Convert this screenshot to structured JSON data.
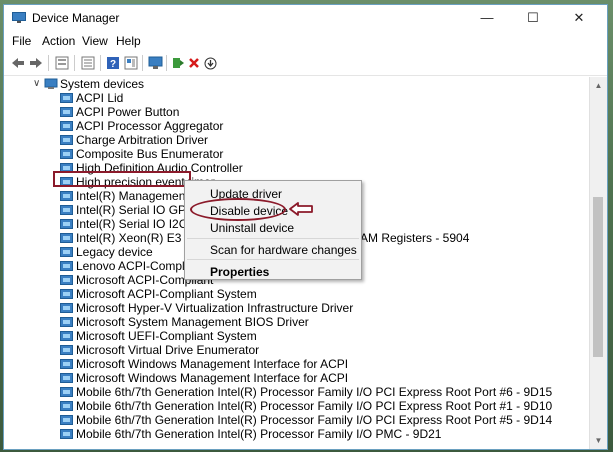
{
  "window": {
    "title": "Device Manager"
  },
  "menubar": {
    "items": [
      {
        "label": "File"
      },
      {
        "label": "Action"
      },
      {
        "label": "View"
      },
      {
        "label": "Help"
      }
    ]
  },
  "toolbar": {
    "icons": [
      "back-arrow-icon",
      "forward-arrow-icon",
      "properties-icon",
      "list-icon",
      "help-icon",
      "view-icon",
      "monitor-icon",
      "add-driver-icon",
      "uninstall-x-icon",
      "update-icon"
    ]
  },
  "tree": {
    "category": {
      "label": "System devices",
      "expanded": true
    },
    "devices": [
      {
        "label": "ACPI Lid"
      },
      {
        "label": "ACPI Power Button"
      },
      {
        "label": "ACPI Processor Aggregator"
      },
      {
        "label": "Charge Arbitration Driver"
      },
      {
        "label": "Composite Bus Enumerator"
      },
      {
        "label": "High Definition Audio Controller"
      },
      {
        "label": "High precision event timer"
      },
      {
        "label": "Intel(R) Management Engi"
      },
      {
        "label": "Intel(R) Serial IO GPIO Host"
      },
      {
        "label": "Intel(R) Serial IO I2C Host C"
      },
      {
        "label": "Intel(R) Xeon(R) E3 - 1200 v",
        "suffix": "AM Registers - 5904"
      },
      {
        "label": "Legacy device"
      },
      {
        "label": "Lenovo ACPI-Compliant V"
      },
      {
        "label": "Microsoft ACPI-Compliant"
      },
      {
        "label": "Microsoft ACPI-Compliant System"
      },
      {
        "label": "Microsoft Hyper-V Virtualization Infrastructure Driver"
      },
      {
        "label": "Microsoft System Management BIOS Driver"
      },
      {
        "label": "Microsoft UEFI-Compliant System"
      },
      {
        "label": "Microsoft Virtual Drive Enumerator"
      },
      {
        "label": "Microsoft Windows Management Interface for ACPI"
      },
      {
        "label": "Microsoft Windows Management Interface for ACPI"
      },
      {
        "label": "Mobile 6th/7th Generation Intel(R) Processor Family I/O PCI Express Root Port #6 - 9D15"
      },
      {
        "label": "Mobile 6th/7th Generation Intel(R) Processor Family I/O PCI Express Root Port #1 - 9D10"
      },
      {
        "label": "Mobile 6th/7th Generation Intel(R) Processor Family I/O PCI Express Root Port #5 - 9D14"
      },
      {
        "label": "Mobile 6th/7th Generation Intel(R) Processor Family I/O PMC - 9D21"
      }
    ]
  },
  "context_menu": {
    "update": "Update driver",
    "disable": "Disable device",
    "uninstall": "Uninstall device",
    "scan": "Scan for hardware changes",
    "properties": "Properties"
  },
  "colors": {
    "annotation": "#8b1a2a",
    "device_icon": "#3a7fc2"
  }
}
